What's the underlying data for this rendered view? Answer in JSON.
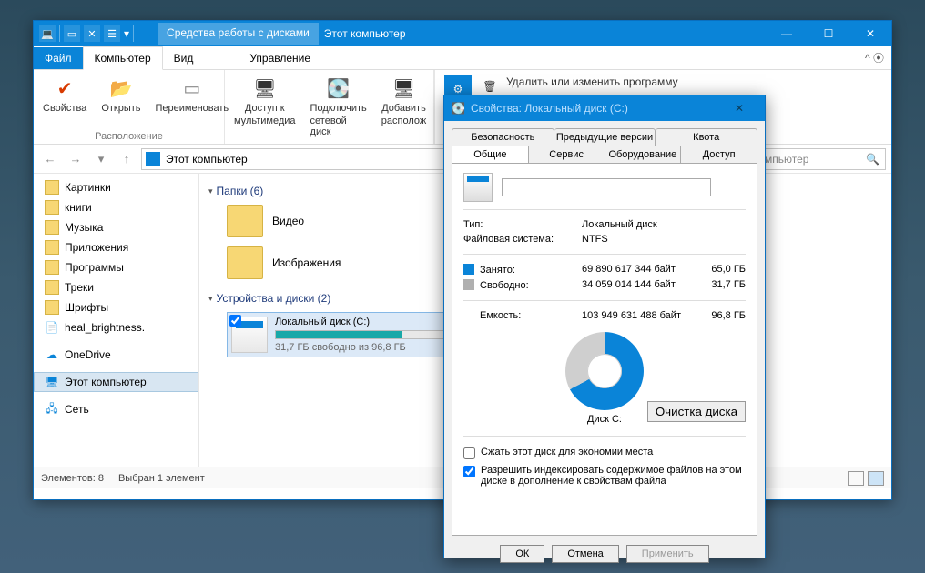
{
  "explorer": {
    "context_label": "Средства работы с дисками",
    "title": "Этот компьютер",
    "tabs": {
      "file": "Файл",
      "computer": "Компьютер",
      "view": "Вид",
      "manage": "Управление"
    },
    "ribbon": {
      "props": "Свойства",
      "open": "Открыть",
      "rename": "Переименовать",
      "media": "Доступ к",
      "media2": "мультимедиа",
      "netdrive": "Подключить",
      "netdrive2": "сетевой диск",
      "addloc": "Добавить",
      "addloc2": "располож",
      "group1": "Расположение",
      "remove": "Удалить или изменить программу"
    },
    "address": "Этот компьютер",
    "search_placeholder": "мпьютер",
    "sidebar": {
      "pictures": "Картинки",
      "books": "книги",
      "music": "Музыка",
      "apps": "Приложения",
      "programs": "Программы",
      "tracks": "Треки",
      "fonts": "Шрифты",
      "heal": "heal_brightness.",
      "onedrive": "OneDrive",
      "thispc": "Этот компьютер",
      "network": "Сеть"
    },
    "content": {
      "folders_head": "Папки (6)",
      "video": "Видео",
      "images": "Изображения",
      "devices_head": "Устройства и диски (2)",
      "drive_name": "Локальный диск (C:)",
      "drive_free": "31,7 ГБ свободно из 96,8 ГБ"
    },
    "status": {
      "count": "Элементов: 8",
      "sel": "Выбран 1 элемент"
    }
  },
  "props": {
    "title": "Свойства: Локальный диск (C:)",
    "tabs_top": {
      "security": "Безопасность",
      "prev": "Предыдущие версии",
      "quota": "Квота"
    },
    "tabs_bot": {
      "general": "Общие",
      "service": "Сервис",
      "hardware": "Оборудование",
      "access": "Доступ"
    },
    "type_label": "Тип:",
    "type_val": "Локальный диск",
    "fs_label": "Файловая система:",
    "fs_val": "NTFS",
    "used_label": "Занято:",
    "used_bytes": "69 890 617 344 байт",
    "used_gb": "65,0 ГБ",
    "free_label": "Свободно:",
    "free_bytes": "34 059 014 144 байт",
    "free_gb": "31,7 ГБ",
    "cap_label": "Емкость:",
    "cap_bytes": "103 949 631 488 байт",
    "cap_gb": "96,8 ГБ",
    "disk_label": "Диск C:",
    "clean_btn": "Очистка диска",
    "compress": "Сжать этот диск для экономии места",
    "index": "Разрешить индексировать содержимое файлов на этом диске в дополнение к свойствам файла",
    "ok": "ОК",
    "cancel": "Отмена",
    "apply": "Применить"
  }
}
